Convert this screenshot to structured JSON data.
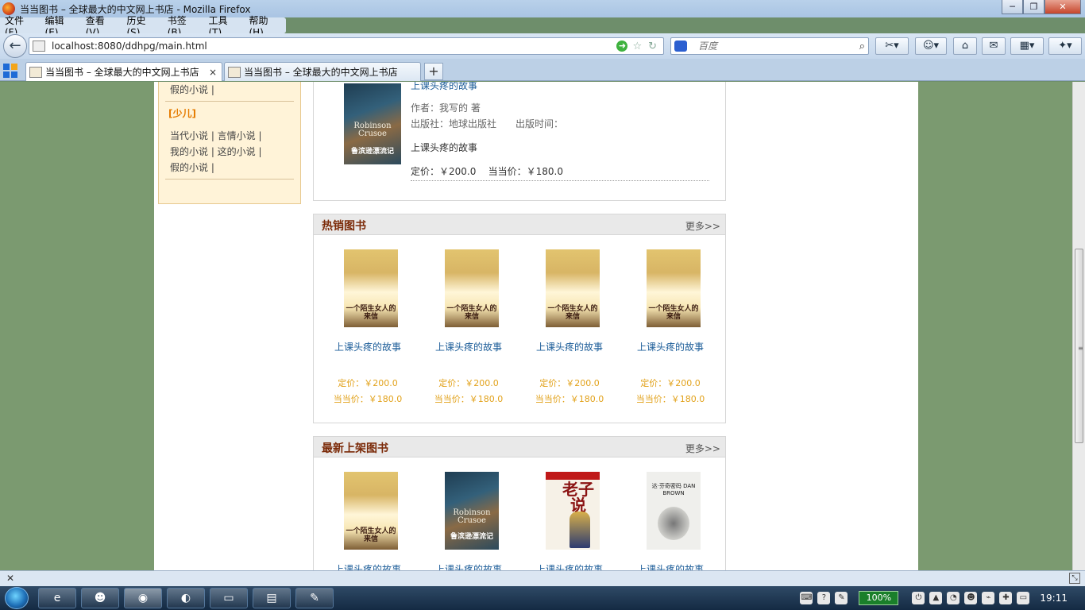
{
  "window": {
    "title": "当当图书 – 全球最大的中文网上书店 - Mozilla Firefox",
    "controls": {
      "minimize": "─",
      "maximize": "❐",
      "close": "✕"
    }
  },
  "menu": [
    "文件(F)",
    "编辑(E)",
    "查看(V)",
    "历史(S)",
    "书签(B)",
    "工具(T)",
    "帮助(H)"
  ],
  "nav": {
    "url": "localhost:8080/ddhpg/main.html",
    "search_placeholder": "百度"
  },
  "tabs": [
    {
      "label": "当当图书 – 全球最大的中文网上书店",
      "close": "×"
    },
    {
      "label": "当当图书 – 全球最大的中文网上书店"
    }
  ],
  "new_tab": "+",
  "sidebar": {
    "top_row": "假的小说 |",
    "category": "[少儿]",
    "rows": [
      "当代小说 | 言情小说 |",
      "我的小说 | 这的小说 |",
      "假的小说 |"
    ]
  },
  "featured": {
    "title": "上课头疼的故事",
    "author": "作者：我写的 著",
    "publisher": "出版社：地球出版社",
    "pubdate": "出版时间：",
    "desc": "上课头疼的故事",
    "price": "定价：￥200.0    当当价：￥180.0",
    "cover_text": "Robinson Crusoe",
    "cover_cn": "鲁滨逊漂流记"
  },
  "hot": {
    "title": "热销图书",
    "more": "更多>>",
    "items": [
      {
        "title": "上课头疼的故事",
        "price": "定价：￥200.0",
        "dd_price": "当当价：￥180.0",
        "cover": "一个陌生女人的来信"
      },
      {
        "title": "上课头疼的故事",
        "price": "定价：￥200.0",
        "dd_price": "当当价：￥180.0",
        "cover": "一个陌生女人的来信"
      },
      {
        "title": "上课头疼的故事",
        "price": "定价：￥200.0",
        "dd_price": "当当价：￥180.0",
        "cover": "一个陌生女人的来信"
      },
      {
        "title": "上课头疼的故事",
        "price": "定价：￥200.0",
        "dd_price": "当当价：￥180.0",
        "cover": "一个陌生女人的来信"
      }
    ]
  },
  "newest": {
    "title": "最新上架图书",
    "more": "更多>>",
    "items": [
      {
        "title": "上课头疼的故事",
        "cover": "一个陌生女人的来信"
      },
      {
        "title": "上课头疼的故事",
        "cover": "鲁滨逊漂流记",
        "cover_en": "Robinson Crusoe"
      },
      {
        "title": "上课头疼的故事",
        "cover": "老子说"
      },
      {
        "title": "上课头疼的故事",
        "cover": "达·芬奇密码 DAN BROWN"
      }
    ]
  },
  "taskbar": {
    "battery": "100%",
    "clock": "19:11"
  }
}
